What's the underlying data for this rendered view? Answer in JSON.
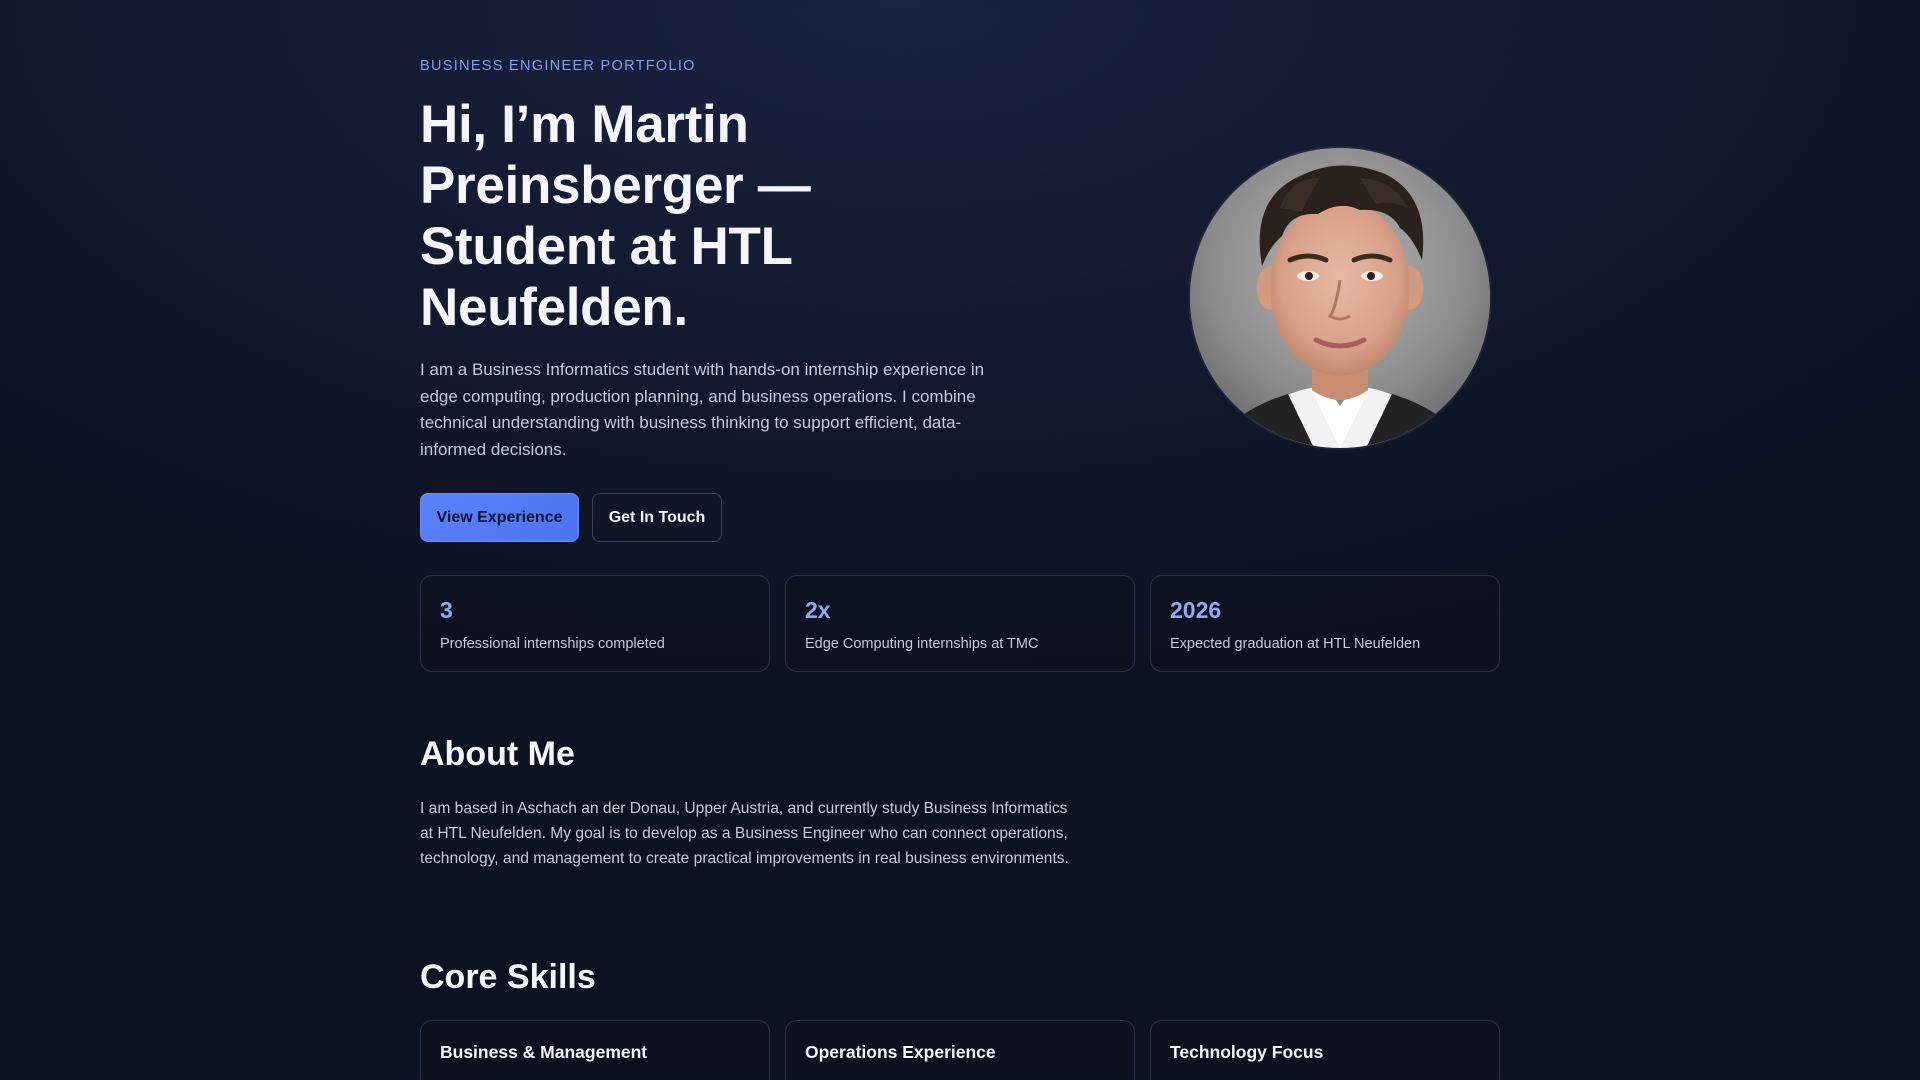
{
  "hero": {
    "eyebrow": "BUSINESS ENGINEER PORTFOLIO",
    "title": "Hi, I’m Martin Preinsberger — Student at HTL Neufelden.",
    "description": "I am a Business Informatics student with hands-on internship experience in edge computing, production planning, and business operations. I combine technical understanding with business thinking to support efficient, data-informed decisions.",
    "primary_button": "View Experience",
    "secondary_button": "Get In Touch"
  },
  "stats": [
    {
      "value": "3",
      "label": "Professional internships completed"
    },
    {
      "value": "2x",
      "label": "Edge Computing internships at TMC"
    },
    {
      "value": "2026",
      "label": "Expected graduation at HTL Neufelden"
    }
  ],
  "about": {
    "title": "About Me",
    "text": "I am based in Aschach an der Donau, Upper Austria, and currently study Business Informatics at HTL Neufelden. My goal is to develop as a Business Engineer who can connect operations, technology, and management to create practical improvements in real business environments."
  },
  "skills": {
    "title": "Core Skills",
    "cards": [
      {
        "title": "Business & Management"
      },
      {
        "title": "Operations Experience"
      },
      {
        "title": "Technology Focus"
      }
    ]
  },
  "colors": {
    "accent": "#5a82ff",
    "accent_text": "#8eaaf5",
    "eyebrow": "#7f9ff0",
    "background": "#0f1426"
  },
  "icons": {
    "avatar": "profile-photo"
  }
}
